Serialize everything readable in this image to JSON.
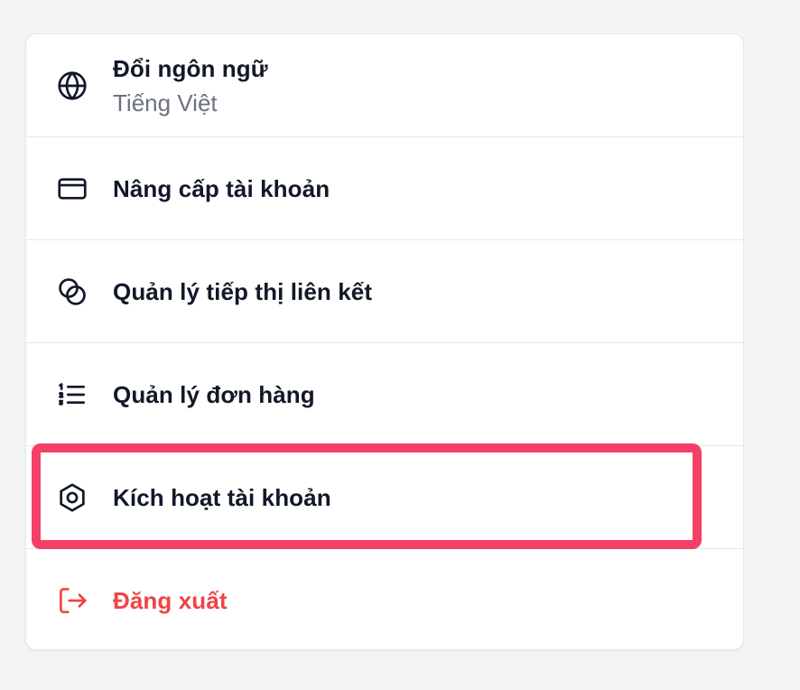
{
  "menu": {
    "items": [
      {
        "label": "Đổi ngôn ngữ",
        "sublabel": "Tiếng Việt",
        "icon": "globe-icon"
      },
      {
        "label": "Nâng cấp tài khoản",
        "icon": "credit-card-icon"
      },
      {
        "label": "Quản lý tiếp thị liên kết",
        "icon": "linked-circles-icon"
      },
      {
        "label": "Quản lý đơn hàng",
        "icon": "numbered-list-icon"
      },
      {
        "label": "Kích hoạt tài khoản",
        "icon": "hexagon-icon",
        "highlighted": true
      },
      {
        "label": "Đăng xuất",
        "icon": "logout-icon",
        "danger": true
      }
    ]
  },
  "colors": {
    "background": "#f3f4f6",
    "card": "#ffffff",
    "text": "#111827",
    "muted": "#6b7280",
    "danger": "#ef4444",
    "highlight": "#f43f66",
    "divider": "#e5e7eb"
  }
}
